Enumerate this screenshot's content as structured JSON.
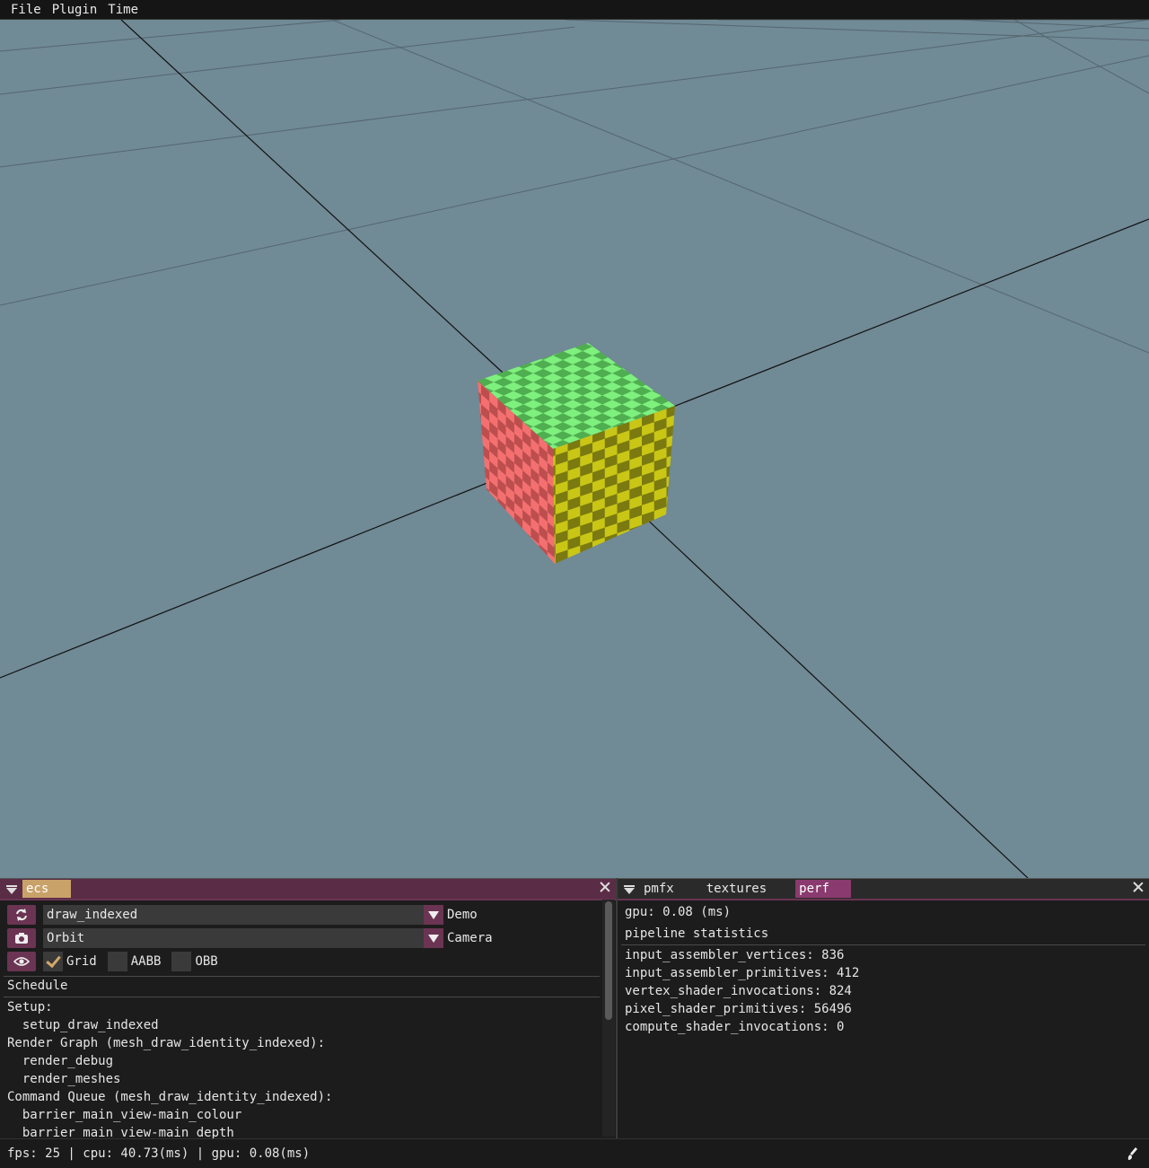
{
  "menubar": {
    "items": [
      "File",
      "Plugin",
      "Time"
    ]
  },
  "scene": {
    "background": "#708a96",
    "cube": {
      "top_colors": [
        "#7ef07e",
        "#4fae4f"
      ],
      "left_colors": [
        "#f47070",
        "#bd4e4e"
      ],
      "right_colors": [
        "#c9c616",
        "#7a7a10"
      ]
    }
  },
  "ecs_panel": {
    "tab": "ecs",
    "demo_combo": {
      "value": "draw_indexed",
      "label": "Demo"
    },
    "camera_combo": {
      "value": "Orbit",
      "label": "Camera"
    },
    "toggles": [
      {
        "label": "Grid",
        "checked": true
      },
      {
        "label": "AABB",
        "checked": false
      },
      {
        "label": "OBB",
        "checked": false
      }
    ],
    "schedule_header": "Schedule",
    "schedule_lines": [
      "Setup:",
      "  setup_draw_indexed",
      "Render Graph (mesh_draw_identity_indexed):",
      "  render_debug",
      "  render_meshes",
      "Command Queue (mesh_draw_identity_indexed):",
      "  barrier_main_view-main_colour",
      "  barrier_main_view-main_depth"
    ]
  },
  "perf_panel": {
    "tabs": [
      "pmfx",
      "textures",
      "perf"
    ],
    "active_tab": "perf",
    "gpu_time": "gpu: 0.08 (ms)",
    "pipeline_header": "pipeline statistics",
    "stats": [
      "input_assembler_vertices: 836",
      "input_assembler_primitives: 412",
      "vertex_shader_invocations: 824",
      "pixel_shader_primitives: 56496",
      "compute_shader_invocations: 0"
    ]
  },
  "statusbar": {
    "text": "fps: 25 | cpu: 40.73(ms) | gpu: 0.08(ms)"
  },
  "icons": [
    "refresh-icon",
    "camera-icon",
    "eye-icon",
    "brush-icon",
    "dropdown-arrow-icon",
    "close-icon",
    "panel-menu-icon"
  ]
}
